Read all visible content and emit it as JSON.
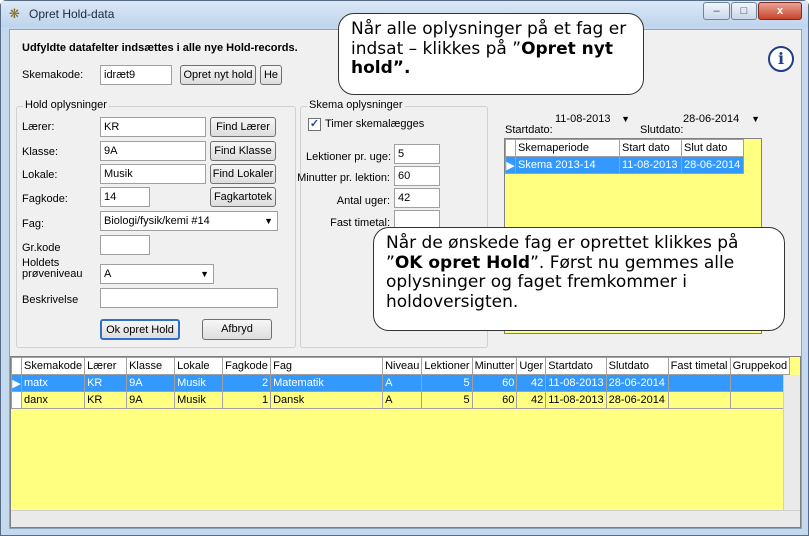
{
  "window": {
    "title": "Opret Hold-data",
    "icon": "wrench-gear-icon",
    "controls": {
      "minimize": "–",
      "maximize": "□",
      "close": "x"
    }
  },
  "heading": "Udfyldte datafelter indsættes i alle nye Hold-records.",
  "skemakode": {
    "label": "Skemakode:",
    "value": "idræt9"
  },
  "top_buttons": {
    "opret_nyt_hold": "Opret nyt hold",
    "partial": "He"
  },
  "hold": {
    "group_title": "Hold oplysninger",
    "laerer": {
      "label": "Lærer:",
      "value": "KR",
      "button": "Find Lærer"
    },
    "klasse": {
      "label": "Klasse:",
      "value": "9A",
      "button": "Find Klasse"
    },
    "lokale": {
      "label": "Lokale:",
      "value": "Musik",
      "button": "Find Lokaler"
    },
    "fagkode": {
      "label": "Fagkode:",
      "value": "14",
      "button": "Fagkartotek"
    },
    "fag": {
      "label": "Fag:",
      "value": "Biologi/fysik/kemi #14"
    },
    "grkode": {
      "label": "Gr.kode",
      "value": ""
    },
    "niveau": {
      "label_line1": "Holdets",
      "label_line2": "prøveniveau",
      "value": "A"
    },
    "beskrivelse": {
      "label": "Beskrivelse",
      "value": ""
    }
  },
  "skema": {
    "group_title": "Skema oplysninger",
    "timer_label": "Timer skemalægges",
    "timer_checked": "✓",
    "lektioner": {
      "label": "Lektioner pr. uge:",
      "value": "5"
    },
    "minutter": {
      "label": "Minutter pr. lektion:",
      "value": "60"
    },
    "uger": {
      "label": "Antal uger:",
      "value": "42"
    },
    "fast_timetal": {
      "label": "Fast timetal:",
      "value": ""
    }
  },
  "dates": {
    "start": {
      "label": "Startdato:",
      "value": "11-08-2013"
    },
    "slut": {
      "label": "Slutdato:",
      "value": "28-06-2014"
    }
  },
  "period_grid": {
    "headers": [
      "Skemaperiode",
      "Start dato",
      "Slut dato"
    ],
    "rows": [
      [
        "Skema 2013-14",
        "11-08-2013",
        "28-06-2014"
      ]
    ]
  },
  "bottom_buttons": {
    "ok": "Ok opret Hold",
    "cancel": "Afbryd"
  },
  "main_grid": {
    "headers": [
      "Skemakode",
      "Lærer",
      "Klasse",
      "Lokale",
      "Fagkode",
      "Fag",
      "Niveau",
      "Lektioner",
      "Minutter",
      "Uger",
      "Startdato",
      "Slutdato",
      "Fast timetal",
      "Gruppekod"
    ],
    "rows": [
      [
        "matx",
        "KR",
        "9A",
        "Musik",
        "2",
        "Matematik",
        "A",
        "5",
        "60",
        "42",
        "11-08-2013",
        "28-06-2014",
        "",
        ""
      ],
      [
        "danx",
        "KR",
        "9A",
        "Musik",
        "1",
        "Dansk",
        "A",
        "5",
        "60",
        "42",
        "11-08-2013",
        "28-06-2014",
        "",
        ""
      ]
    ]
  },
  "callout1": {
    "text1": "Når alle oplysninger på et fag er indsat – klikkes på ”",
    "bold": "Opret nyt hold”."
  },
  "callout2": {
    "text1": "Når de ønskede fag er oprettet klikkes på ”",
    "bold": "OK opret Hold",
    "text2": "”.  Først nu gemmes alle oplysninger og faget fremkommer i holdoversigten."
  }
}
